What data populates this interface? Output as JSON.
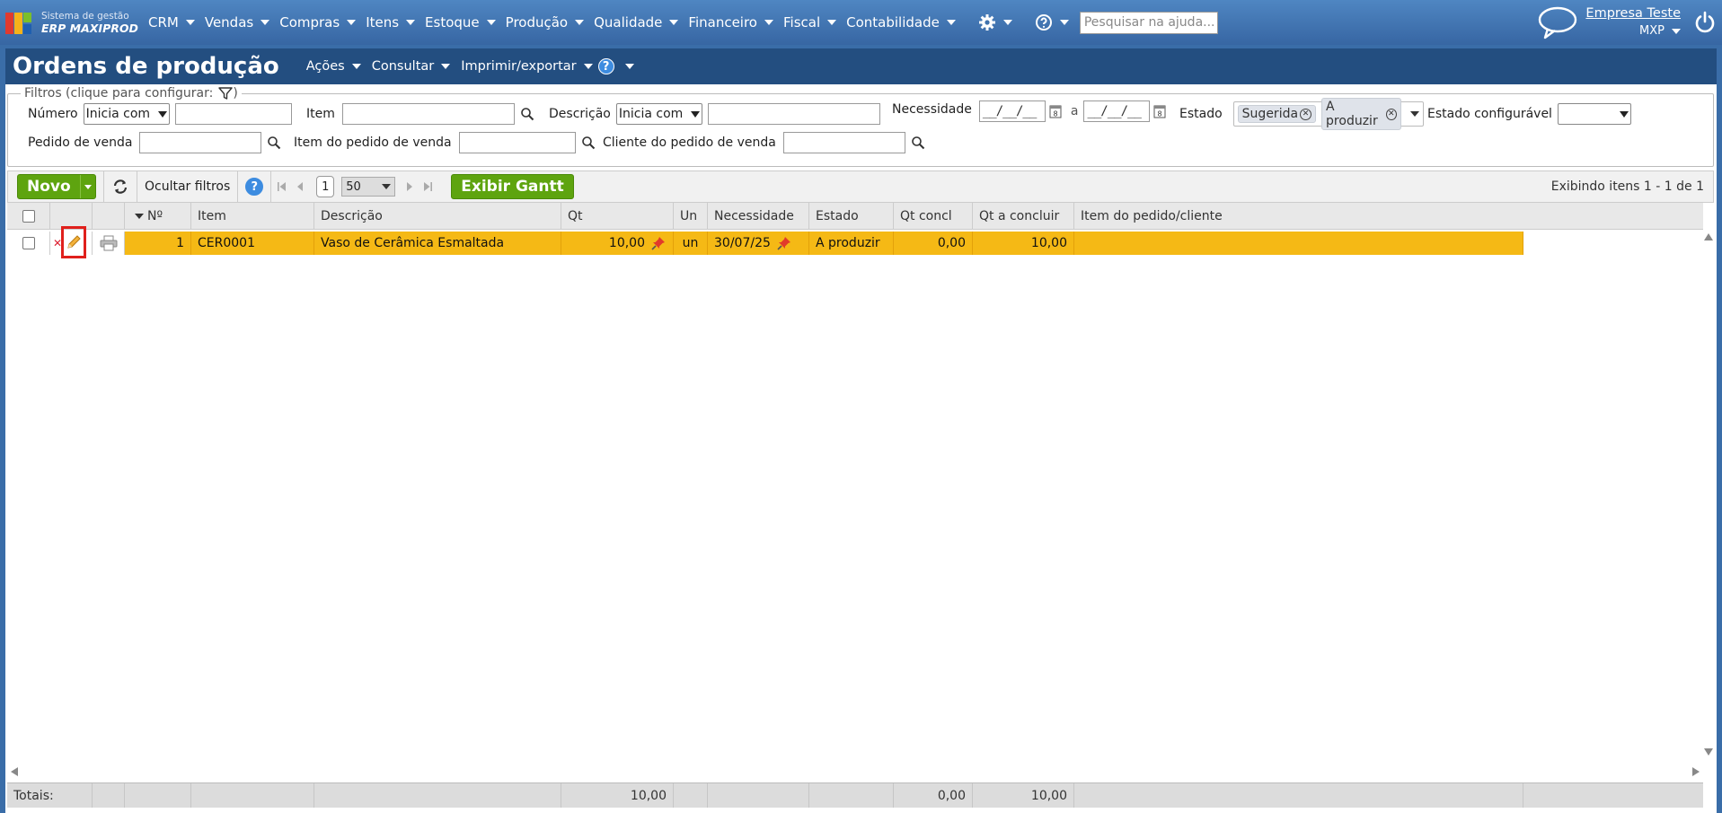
{
  "logo": {
    "line1": "Sistema de gestão",
    "line2": "ERP MAXIPROD"
  },
  "menu": [
    "CRM",
    "Vendas",
    "Compras",
    "Itens",
    "Estoque",
    "Produção",
    "Qualidade",
    "Financeiro",
    "Fiscal",
    "Contabilidade"
  ],
  "search": {
    "placeholder": "Pesquisar na ajuda..."
  },
  "company": {
    "name": "Empresa Teste",
    "user": "MXP"
  },
  "page": {
    "title": "Ordens de produção",
    "menus": [
      "Ações",
      "Consultar",
      "Imprimir/exportar"
    ],
    "help_label": "?"
  },
  "filters": {
    "legend": "Filtros (clique para configurar:",
    "legend_close": ")",
    "numero_label": "Número",
    "numero_mode": "Inicia com",
    "item_label": "Item",
    "descricao_label": "Descrição",
    "descricao_mode": "Inicia com",
    "necessidade_label": "Necessidade",
    "date_mask": "__/__/__",
    "date_sep": "a",
    "estado_label": "Estado",
    "estado_tags": [
      "Sugerida",
      "A produzir"
    ],
    "estado_config_label": "Estado configurável",
    "pedido_label": "Pedido de venda",
    "item_pedido_label": "Item do pedido de venda",
    "cliente_label": "Cliente do pedido de venda"
  },
  "toolbar": {
    "novo": "Novo",
    "hide_filters": "Ocultar filtros",
    "help_label": "?",
    "page": "1",
    "page_size": "50",
    "gantt": "Exibir Gantt",
    "showing": "Exibindo itens 1 - 1 de 1"
  },
  "grid": {
    "columns": [
      "Nº",
      "Item",
      "Descrição",
      "Qt",
      "Un",
      "Necessidade",
      "Estado",
      "Qt concl",
      "Qt a concluir",
      "Item do pedido/cliente"
    ],
    "rows": [
      {
        "numero": "1",
        "item": "CER0001",
        "descricao": "Vaso de Cerâmica Esmaltada",
        "qt": "10,00",
        "un": "un",
        "necessidade": "30/07/25",
        "estado": "A produzir",
        "qt_concl": "0,00",
        "qt_a_concluir": "10,00",
        "item_pedido": ""
      }
    ],
    "totals": {
      "label": "Totais:",
      "qt": "10,00",
      "qt_concl": "0,00",
      "qt_a_concluir": "10,00"
    }
  },
  "colors": {
    "topbar": "#3766a3",
    "header": "#234e80",
    "row_highlight": "#f5b915",
    "green": "#5ea40f",
    "edit_highlight": "#e0201c"
  }
}
